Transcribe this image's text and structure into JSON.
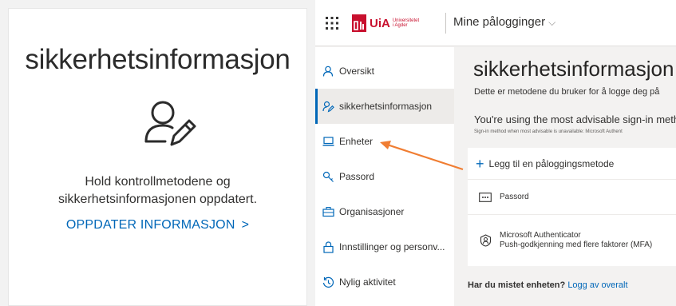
{
  "card": {
    "title": "sikkerhetsinformasjon",
    "description_line1": "Hold kontrollmetodene og",
    "description_line2": "sikkerhetsinformasjonen oppdatert.",
    "link_label": "OPPDATER INFORMASJON",
    "link_chevron": ">",
    "icon": "person-edit-icon"
  },
  "topbar": {
    "logo_text": "UiA",
    "logo_small": "Universitetet i Agder",
    "app_title": "Mine pålogginger",
    "app_title_chevron": "⌵"
  },
  "nav": {
    "items": [
      {
        "label": "Oversikt",
        "icon": "person-icon"
      },
      {
        "label": "sikkerhetsinformasjon",
        "icon": "person-edit-icon",
        "active": true
      },
      {
        "label": "Enheter",
        "icon": "laptop-icon"
      },
      {
        "label": "Passord",
        "icon": "key-icon"
      },
      {
        "label": "Organisasjoner",
        "icon": "briefcase-icon"
      },
      {
        "label": "Innstillinger og personv...",
        "icon": "lock-icon"
      },
      {
        "label": "Nylig aktivitet",
        "icon": "history-icon"
      }
    ]
  },
  "main": {
    "title": "sikkerhetsinformasjon",
    "subtitle": "Dette er metodene du bruker for å logge deg på",
    "advisable": "You're using the most advisable sign-in metho",
    "advisable_tiny": "Sign-in method when most advisable is unavailable: Microsoft Authent",
    "add_method": "Legg til en påloggingsmetode",
    "methods": [
      {
        "line1": "Passord",
        "line2": "",
        "icon": "password-dots-icon"
      },
      {
        "line1": "Microsoft Authenticator",
        "line2": "Push-godkjenning med flere faktorer (MFA)",
        "icon": "authenticator-icon"
      }
    ],
    "lost_bold": "Har du mistet enheten?",
    "lost_link": "Logg av overalt"
  },
  "colors": {
    "accent": "#0067b8",
    "brand": "#c8102e",
    "arrow": "#f07d32"
  }
}
